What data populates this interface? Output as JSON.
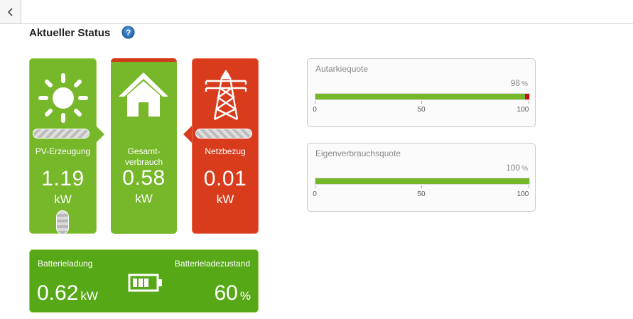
{
  "header": {
    "title": "Aktueller Status"
  },
  "tiles": {
    "pv": {
      "label": "PV-Erzeugung",
      "value": "1.19",
      "unit": "kW"
    },
    "gesamt": {
      "label_line1": "Gesamt-",
      "label_line2": "verbrauch",
      "value": "0.58",
      "unit": "kW"
    },
    "netz": {
      "label": "Netzbezug",
      "value": "0.01",
      "unit": "kW"
    }
  },
  "battery": {
    "charge_label": "Batterieladung",
    "charge_value": "0.62",
    "charge_unit": "kW",
    "state_label": "Batterieladezustand",
    "state_value": "60",
    "state_unit": "%"
  },
  "quotas": [
    {
      "label": "Autarkiequote",
      "value": "98",
      "unit": "%",
      "fraction": 0.98,
      "ticks": [
        "0",
        "50",
        "100"
      ]
    },
    {
      "label": "Eigenverbrauchsquote",
      "value": "100",
      "unit": "%",
      "fraction": 1.0,
      "ticks": [
        "0",
        "50",
        "100"
      ]
    }
  ],
  "icons": {
    "back": "chevron-left-icon",
    "help": "help-icon",
    "pv": "sun-icon",
    "consumption": "house-icon",
    "grid": "power-pylon-icon",
    "battery": "battery-icon"
  },
  "colors": {
    "green": "#77b72a",
    "red": "#d83c1c",
    "battery_green": "#56a817",
    "help_blue": "#2a6fb8"
  }
}
